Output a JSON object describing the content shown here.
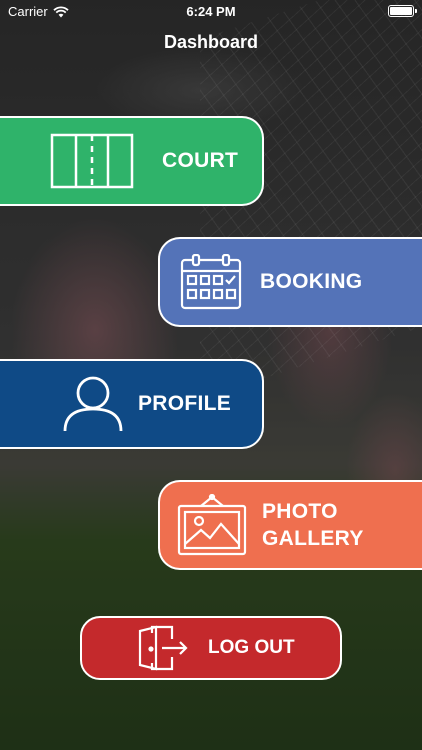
{
  "status_bar": {
    "carrier": "Carrier",
    "time": "6:24 PM",
    "wifi_icon": "wifi-icon",
    "battery_icon": "battery-icon"
  },
  "header": {
    "title": "Dashboard"
  },
  "menu": {
    "court": {
      "label": "COURT",
      "icon": "court-icon",
      "color": "#2fb36a"
    },
    "booking": {
      "label": "BOOKING",
      "icon": "calendar-icon",
      "color": "#5473b8"
    },
    "profile": {
      "label": "PROFILE",
      "icon": "user-icon",
      "color": "#0f4a86"
    },
    "gallery": {
      "label": "PHOTO\nGALLERY",
      "icon": "picture-frame-icon",
      "color": "#ef6f4f"
    },
    "logout": {
      "label": "LOG OUT",
      "icon": "exit-door-icon",
      "color": "#c4292c"
    }
  }
}
